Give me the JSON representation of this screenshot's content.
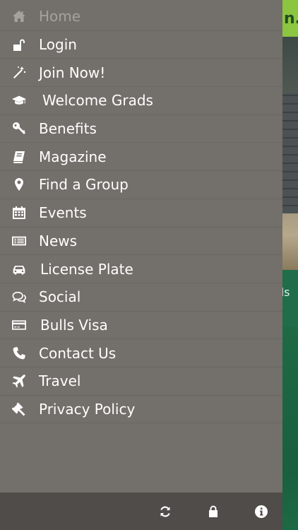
{
  "menu": {
    "items": [
      {
        "label": "Home",
        "icon": "home-icon"
      },
      {
        "label": "Login",
        "icon": "unlock-icon"
      },
      {
        "label": "Join Now!",
        "icon": "magic-wand-icon"
      },
      {
        "label": "Welcome Grads",
        "icon": "graduation-cap-icon"
      },
      {
        "label": "Benefits",
        "icon": "key-icon"
      },
      {
        "label": "Magazine",
        "icon": "book-icon"
      },
      {
        "label": "Find a Group",
        "icon": "map-marker-icon"
      },
      {
        "label": "Events",
        "icon": "calendar-icon"
      },
      {
        "label": "News",
        "icon": "newspaper-icon"
      },
      {
        "label": "License Plate",
        "icon": "car-icon"
      },
      {
        "label": "Social",
        "icon": "chat-icon"
      },
      {
        "label": "Bulls Visa",
        "icon": "credit-card-icon"
      },
      {
        "label": "Contact Us",
        "icon": "phone-icon"
      },
      {
        "label": "Travel",
        "icon": "plane-icon"
      },
      {
        "label": "Privacy Policy",
        "icon": "gavel-icon"
      }
    ],
    "active_index": 0
  },
  "footer": {
    "icons": [
      "refresh-icon",
      "lock-icon",
      "info-icon"
    ]
  },
  "background": {
    "brand_fragment": "n.",
    "band_text_fragment": "ds"
  },
  "colors": {
    "menu_bg": "#736f6a",
    "footer_bg": "#4f4c49",
    "brand_green": "#8cc540",
    "band_green": "#1f6d49"
  }
}
